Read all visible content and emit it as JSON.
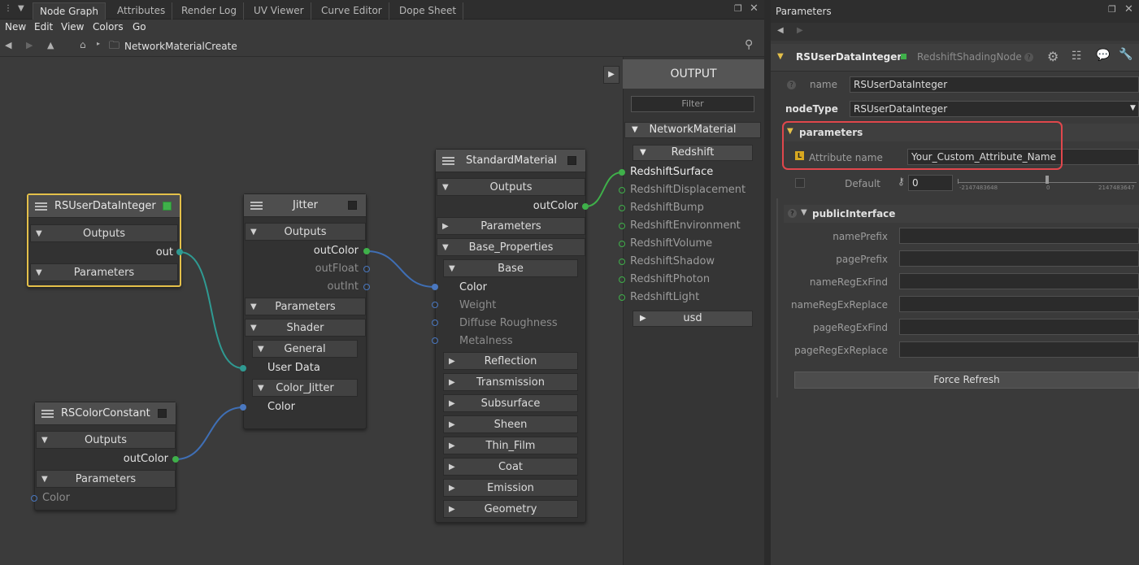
{
  "tabs": [
    "Node Graph",
    "Attributes",
    "Render Log",
    "UV Viewer",
    "Curve Editor",
    "Dope Sheet"
  ],
  "menu": [
    "New",
    "Edit",
    "View",
    "Colors",
    "Go"
  ],
  "breadcrumb": "NetworkMaterialCreate",
  "nodes": {
    "user_data": {
      "title": "RSUserDataInteger",
      "outputs": "Outputs",
      "out_port": "out",
      "parameters": "Parameters"
    },
    "jitter": {
      "title": "Jitter",
      "outputs": "Outputs",
      "out_color": "outColor",
      "out_float": "outFloat",
      "out_int": "outInt",
      "parameters": "Parameters",
      "shader": "Shader",
      "general": "General",
      "user_data": "User Data",
      "color_jitter": "Color_Jitter",
      "color": "Color"
    },
    "color_constant": {
      "title": "RSColorConstant",
      "outputs": "Outputs",
      "out_color": "outColor",
      "parameters": "Parameters",
      "color": "Color"
    },
    "standard_material": {
      "title": "StandardMaterial",
      "outputs": "Outputs",
      "out_color": "outColor",
      "parameters": "Parameters",
      "base_properties": "Base_Properties",
      "base": "Base",
      "color": "Color",
      "weight": "Weight",
      "diffuse_roughness": "Diffuse Roughness",
      "metalness": "Metalness",
      "sections": [
        "Reflection",
        "Transmission",
        "Subsurface",
        "Sheen",
        "Thin_Film",
        "Coat",
        "Emission",
        "Geometry"
      ]
    }
  },
  "output_panel": {
    "title": "OUTPUT",
    "filter": "Filter",
    "network_material": "NetworkMaterial",
    "redshift": "Redshift",
    "items": [
      "RedshiftSurface",
      "RedshiftDisplacement",
      "RedshiftBump",
      "RedshiftEnvironment",
      "RedshiftVolume",
      "RedshiftShadow",
      "RedshiftPhoton",
      "RedshiftLight"
    ],
    "usd": "usd"
  },
  "parameters_panel": {
    "title": "Parameters",
    "node_name": "RSUserDataInteger",
    "node_class": "RedshiftShadingNode",
    "name_label": "name",
    "name_value": "RSUserDataInteger",
    "nodetype_label": "nodeType",
    "nodetype_value": "RSUserDataInteger",
    "parameters_group": "parameters",
    "attribute_name_label": "Attribute name",
    "attribute_name_value": "Your_Custom_Attribute_Name",
    "default_label": "Default",
    "default_value": "0",
    "slider_min": "-2147483648",
    "slider_mid": "0",
    "slider_max": "2147483647",
    "slider_level": 0.5,
    "public_interface_group": "publicInterface",
    "public_fields": [
      {
        "label": "namePrefix",
        "value": ""
      },
      {
        "label": "pagePrefix",
        "value": ""
      },
      {
        "label": "nameRegExFind",
        "value": ""
      },
      {
        "label": "nameRegExReplace",
        "value": ""
      },
      {
        "label": "pageRegExFind",
        "value": ""
      },
      {
        "label": "pageRegExReplace",
        "value": ""
      }
    ],
    "force_refresh": "Force Refresh"
  },
  "colors": {
    "selected_border": "#e4c04a",
    "highlight_border": "#e0474c",
    "green_port": "#3fb04a",
    "blue_port": "#4a78c0"
  }
}
